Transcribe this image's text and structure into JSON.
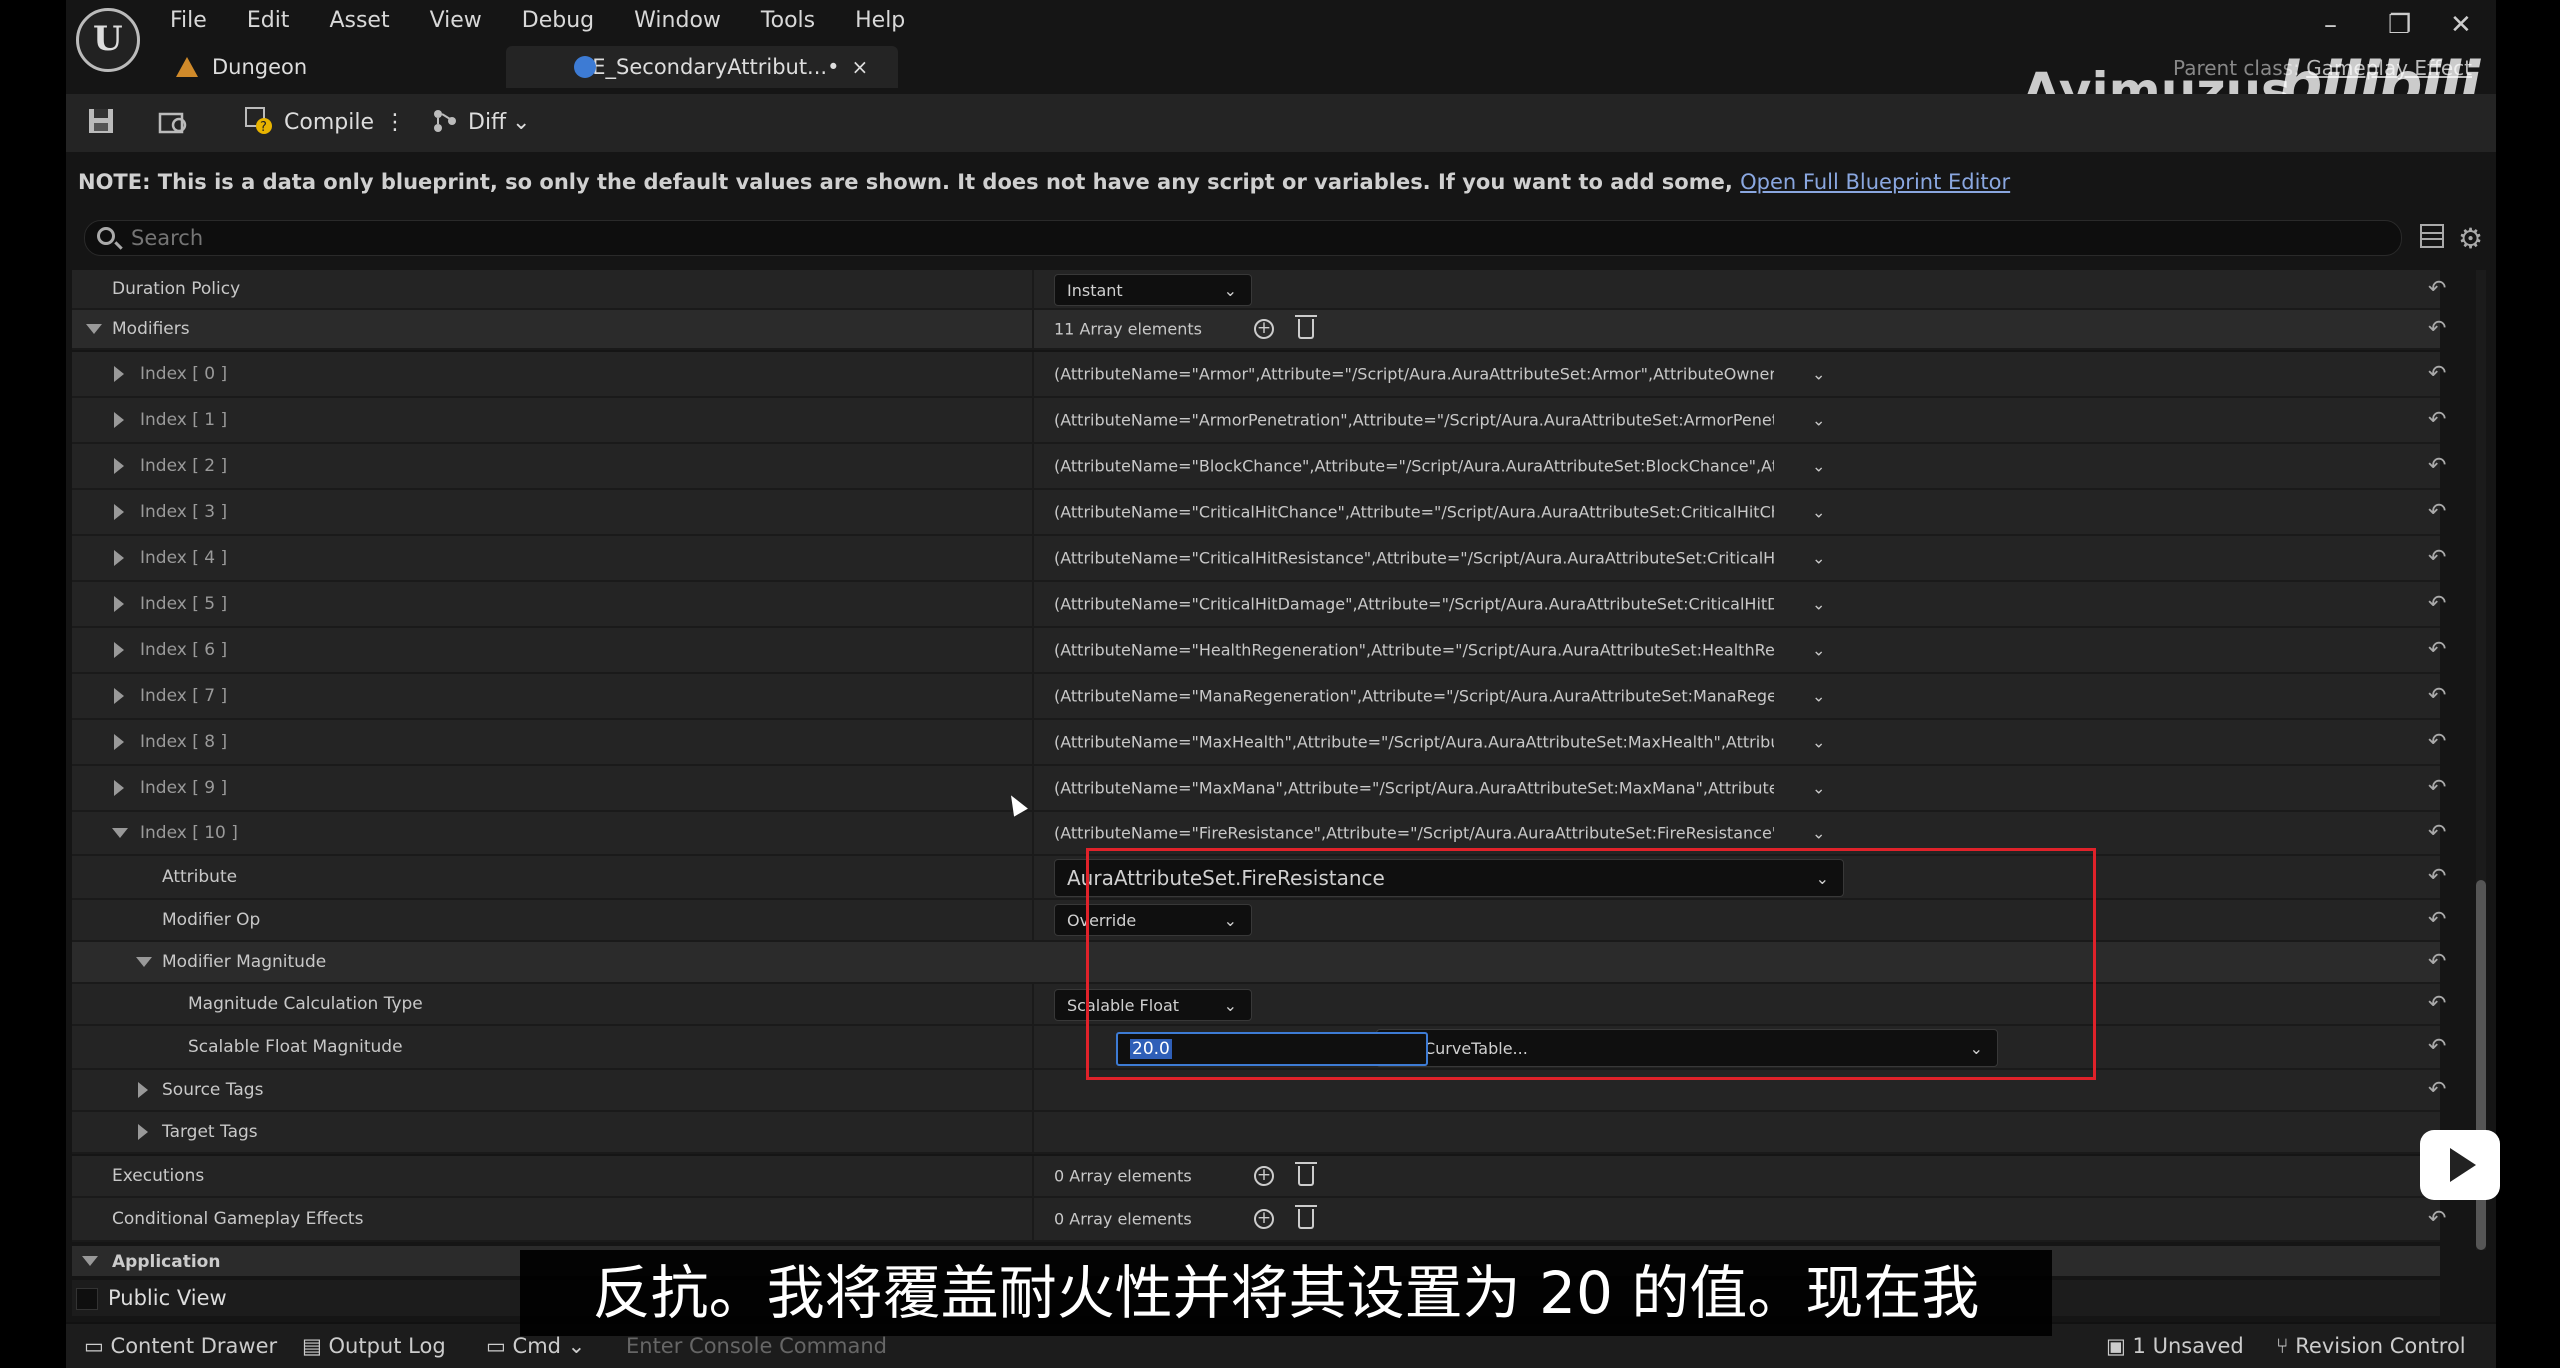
{
  "menu": [
    "File",
    "Edit",
    "Asset",
    "View",
    "Debug",
    "Window",
    "Tools",
    "Help"
  ],
  "tabs": [
    {
      "label": "Dungeon"
    },
    {
      "label": "GE_SecondaryAttribut...•"
    }
  ],
  "tab_close": "×",
  "parent_class": {
    "label": "Parent class:",
    "value": "Gameplay Effect"
  },
  "watermark": {
    "text": "Ayimuzus",
    "logo": "bilibili"
  },
  "toolbar": {
    "compile": "Compile",
    "diff": "Diff"
  },
  "note": {
    "text": "NOTE: This is a data only blueprint, so only the default values are shown.  It does not have any script or variables.  If you want to add some,",
    "link": "Open Full Blueprint Editor"
  },
  "search": {
    "placeholder": "Search"
  },
  "rows": {
    "duration_policy": {
      "label": "Duration Policy",
      "value": "Instant"
    },
    "modifiers": {
      "label": "Modifiers",
      "value": "11 Array elements"
    },
    "indices": [
      {
        "label": "Index [ 0 ]",
        "value": "(AttributeName=\"Armor\",Attribute=\"/Script/Aura.AuraAttributeSet:Armor\",AttributeOwner=/Script/Co"
      },
      {
        "label": "Index [ 1 ]",
        "value": "(AttributeName=\"ArmorPenetration\",Attribute=\"/Script/Aura.AuraAttributeSet:ArmorPenetration\",Attr"
      },
      {
        "label": "Index [ 2 ]",
        "value": "(AttributeName=\"BlockChance\",Attribute=\"/Script/Aura.AuraAttributeSet:BlockChance\",AttributeOwn"
      },
      {
        "label": "Index [ 3 ]",
        "value": "(AttributeName=\"CriticalHitChance\",Attribute=\"/Script/Aura.AuraAttributeSet:CriticalHitChance\",Attrit"
      },
      {
        "label": "Index [ 4 ]",
        "value": "(AttributeName=\"CriticalHitResistance\",Attribute=\"/Script/Aura.AuraAttributeSet:CriticalHitResistanc"
      },
      {
        "label": "Index [ 5 ]",
        "value": "(AttributeName=\"CriticalHitDamage\",Attribute=\"/Script/Aura.AuraAttributeSet:CriticalHitDamage\",Att"
      },
      {
        "label": "Index [ 6 ]",
        "value": "(AttributeName=\"HealthRegeneration\",Attribute=\"/Script/Aura.AuraAttributeSet:HealthRegeneration\","
      },
      {
        "label": "Index [ 7 ]",
        "value": "(AttributeName=\"ManaRegeneration\",Attribute=\"/Script/Aura.AuraAttributeSet:ManaRegeneration\",A"
      },
      {
        "label": "Index [ 8 ]",
        "value": "(AttributeName=\"MaxHealth\",Attribute=\"/Script/Aura.AuraAttributeSet:MaxHealth\",AttributeOwner=/S"
      },
      {
        "label": "Index [ 9 ]",
        "value": "(AttributeName=\"MaxMana\",Attribute=\"/Script/Aura.AuraAttributeSet:MaxMana\",AttributeOwner=/Sc"
      },
      {
        "label": "Index [ 10 ]",
        "value": "(AttributeName=\"FireResistance\",Attribute=\"/Script/Aura.AuraAttributeSet:FireResistance\",AttributeC"
      }
    ],
    "attribute": {
      "label": "Attribute",
      "value": "AuraAttributeSet.FireResistance"
    },
    "modifier_op": {
      "label": "Modifier Op",
      "value": "Override"
    },
    "modifier_magnitude": {
      "label": "Modifier Magnitude"
    },
    "magnitude_calc_type": {
      "label": "Magnitude Calculation Type",
      "value": "Scalable Float"
    },
    "scalable_float": {
      "label": "Scalable Float Magnitude",
      "value": "20.0",
      "curve": "Use CurveTable..."
    },
    "source_tags": {
      "label": "Source Tags"
    },
    "target_tags": {
      "label": "Target Tags"
    },
    "executions": {
      "label": "Executions",
      "value": "0 Array elements"
    },
    "conditional": {
      "label": "Conditional Gameplay Effects",
      "value": "0 Array elements"
    },
    "application": {
      "label": "Application"
    },
    "public_view": {
      "label": "Public View"
    }
  },
  "status_bar": {
    "content_drawer": "Content Drawer",
    "output_log": "Output Log",
    "cmd": "Cmd",
    "console_placeholder": "Enter Console Command",
    "unsaved": "1 Unsaved",
    "revision": "Revision Control"
  },
  "subtitle": "反抗。我将覆盖耐火性并将其设置为 20 的值。现在我",
  "colors": {
    "highlight": "#e0222a",
    "selection": "#3d7bd4",
    "link": "#8aa7e0"
  }
}
